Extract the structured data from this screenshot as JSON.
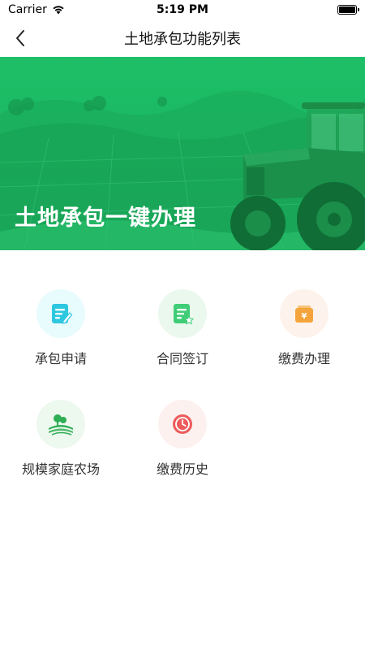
{
  "status_bar": {
    "carrier": "Carrier",
    "time": "5:19 PM",
    "battery_level": 1.0
  },
  "nav": {
    "title": "土地承包功能列表",
    "back_icon": "chevron-left-icon"
  },
  "banner": {
    "title": "土地承包一键办理"
  },
  "functions": [
    {
      "label": "承包申请",
      "icon": "apply-form-icon",
      "bg": "#e8fbfd",
      "color": "#2ec7e0"
    },
    {
      "label": "合同签订",
      "icon": "contract-sign-icon",
      "bg": "#eaf8ee",
      "color": "#3fcd77"
    },
    {
      "label": "缴费办理",
      "icon": "payment-wallet-icon",
      "bg": "#fdf3ec",
      "color": "#f5a43b"
    },
    {
      "label": "规模家庭农场",
      "icon": "family-farm-icon",
      "bg": "#edf8ef",
      "color": "#2fae54"
    },
    {
      "label": "缴费历史",
      "icon": "payment-history-icon",
      "bg": "#fdf1ef",
      "color": "#ee5b5b"
    }
  ]
}
